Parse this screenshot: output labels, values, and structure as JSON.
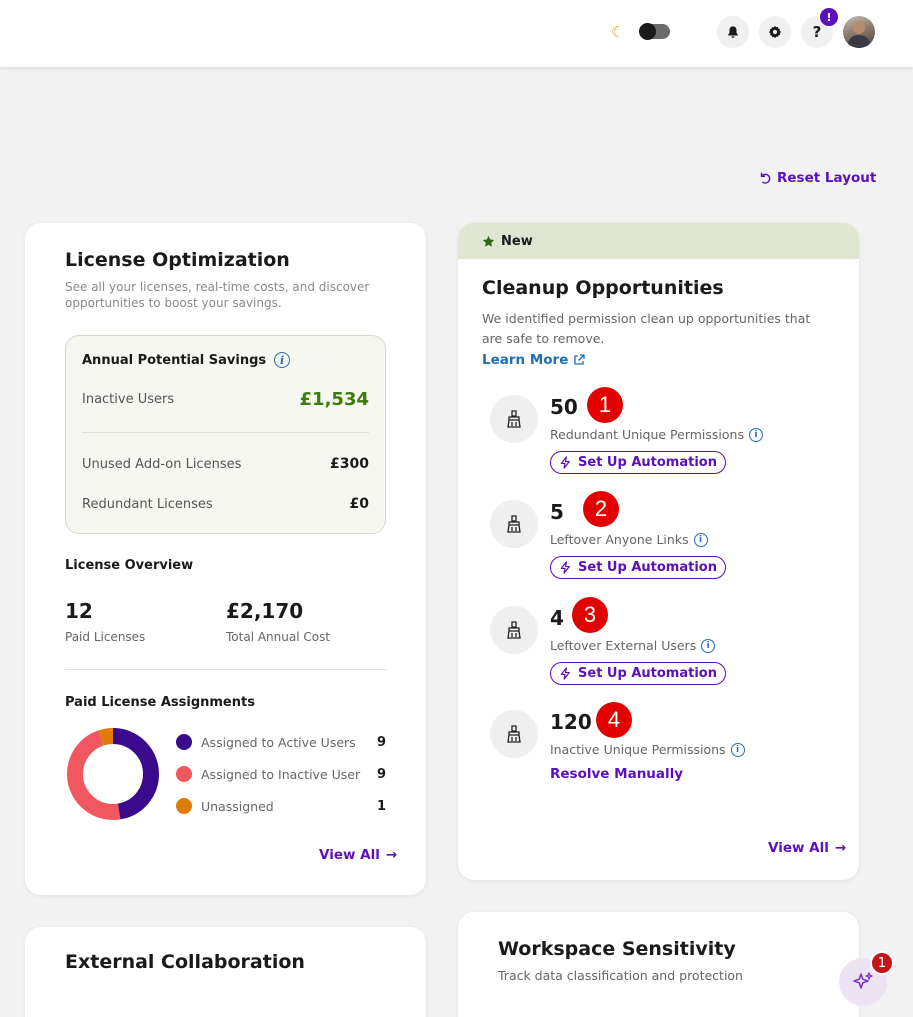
{
  "header": {
    "theme_icon": "moon-icon",
    "notifications_icon": "bell-icon",
    "settings_icon": "gear-icon",
    "help_label": "?",
    "help_badge": "!",
    "avatar": "user-avatar"
  },
  "reset_layout": "Reset Layout",
  "license": {
    "title": "License Optimization",
    "description": "See all your licenses, real-time costs, and discover opportunities to boost your savings.",
    "savings": {
      "title": "Annual Potential Savings",
      "info": "i",
      "rows": [
        {
          "label": "Inactive Users",
          "value": "£1,534"
        },
        {
          "label": "Unused Add-on Licenses",
          "value": "£300"
        },
        {
          "label": "Redundant Licenses",
          "value": "£0"
        }
      ]
    },
    "overview": {
      "title": "License Overview",
      "paid_value": "12",
      "paid_label": "Paid Licenses",
      "cost_value": "£2,170",
      "cost_label": "Total Annual Cost"
    },
    "assignments": {
      "title": "Paid License Assignments",
      "items": [
        {
          "label": "Assigned to Active Users",
          "value": "9",
          "color": "#3b0a8c"
        },
        {
          "label": "Assigned to Inactive User",
          "value": "9",
          "color": "#f0575e"
        },
        {
          "label": "Unassigned",
          "value": "1",
          "color": "#e07b0a"
        }
      ]
    },
    "view_all": "View All"
  },
  "cleanup": {
    "badge": "New",
    "title": "Cleanup Opportunities",
    "description": "We identified permission clean up opportunities that are safe to remove.",
    "learn_more": "Learn More",
    "items": [
      {
        "value": "50",
        "label": "Redundant Unique Permissions",
        "action": "Set Up Automation",
        "marker": "1"
      },
      {
        "value": "5",
        "label": "Leftover Anyone Links",
        "action": "Set Up Automation",
        "marker": "2"
      },
      {
        "value": "4",
        "label": "Leftover External Users",
        "action": "Set Up Automation",
        "marker": "3"
      },
      {
        "value": "120",
        "label": "Inactive Unique Permissions",
        "action": "Resolve Manually",
        "marker": "4"
      }
    ],
    "view_all": "View All"
  },
  "external": {
    "title": "External Collaboration"
  },
  "workspace": {
    "title": "Workspace Sensitivity",
    "description": "Track data classification and protection"
  },
  "assistant": {
    "badge": "1"
  },
  "colors": {
    "accent": "#5b10b8",
    "green": "#3a7d0a",
    "link": "#1f6fb5",
    "marker_red": "#e30000"
  }
}
